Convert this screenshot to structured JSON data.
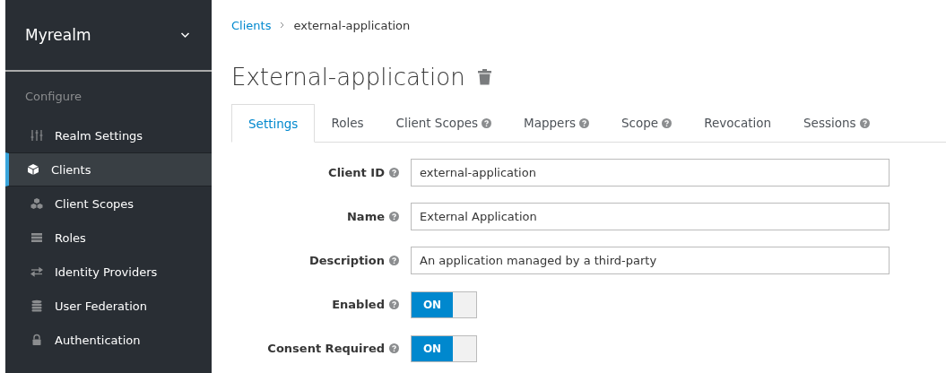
{
  "sidebar": {
    "realm": "Myrealm",
    "section": "Configure",
    "items": [
      {
        "label": "Realm Settings",
        "selected": false
      },
      {
        "label": "Clients",
        "selected": true
      },
      {
        "label": "Client Scopes",
        "selected": false
      },
      {
        "label": "Roles",
        "selected": false
      },
      {
        "label": "Identity Providers",
        "selected": false
      },
      {
        "label": "User Federation",
        "selected": false
      },
      {
        "label": "Authentication",
        "selected": false
      }
    ]
  },
  "breadcrumb": [
    {
      "label": "Clients",
      "kind": "link"
    },
    {
      "label": "external-application",
      "kind": "current"
    }
  ],
  "title": "External-application",
  "tabs": [
    {
      "label": "Settings",
      "help": false,
      "selected": true
    },
    {
      "label": "Roles",
      "help": false,
      "selected": false
    },
    {
      "label": "Client Scopes",
      "help": true,
      "selected": false
    },
    {
      "label": "Mappers",
      "help": true,
      "selected": false
    },
    {
      "label": "Scope",
      "help": true,
      "selected": false
    },
    {
      "label": "Revocation",
      "help": false,
      "selected": false
    },
    {
      "label": "Sessions",
      "help": true,
      "selected": false
    }
  ],
  "fields": [
    {
      "label": "Client ID",
      "kind": "text",
      "value": "external-application"
    },
    {
      "label": "Name",
      "kind": "text",
      "value": "External Application"
    },
    {
      "label": "Description",
      "kind": "text",
      "value": "An application managed by a third-party"
    },
    {
      "label": "Enabled",
      "kind": "toggle",
      "on": true,
      "text": "ON"
    },
    {
      "label": "Consent Required",
      "kind": "toggle",
      "on": true,
      "text": "ON"
    }
  ]
}
